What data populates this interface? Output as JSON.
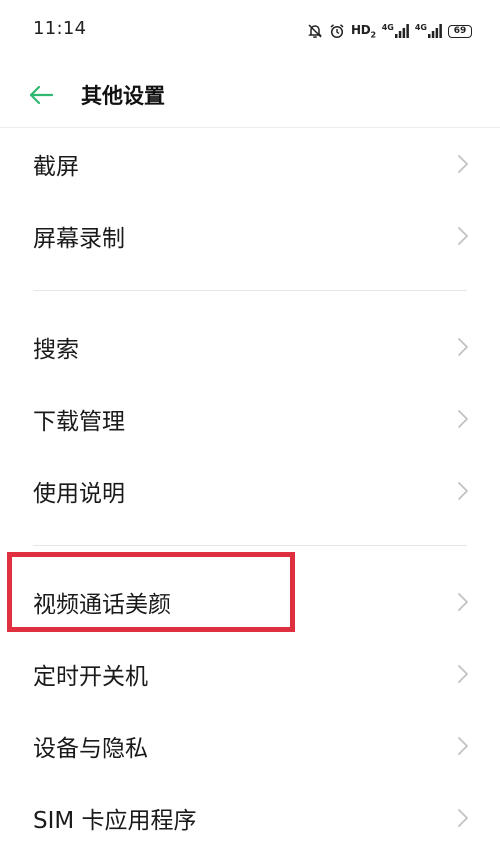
{
  "status_bar": {
    "time": "11:14",
    "hd_label": "HD",
    "hd_sub": "2",
    "network_1": "4G",
    "network_2": "4G",
    "battery": "69",
    "icons": [
      "mute-bell-icon",
      "alarm-clock-icon",
      "signal-4g-icon",
      "signal-4g-icon",
      "battery-icon"
    ]
  },
  "header": {
    "title": "其他设置",
    "back_icon": "arrow-left-icon",
    "accent_color": "#2eb872"
  },
  "items": [
    {
      "label": "截屏"
    },
    {
      "label": "屏幕录制"
    },
    {
      "label": "搜索"
    },
    {
      "label": "下载管理"
    },
    {
      "label": "使用说明"
    },
    {
      "label": "视频通话美颜"
    },
    {
      "label": "定时开关机"
    },
    {
      "label": "设备与隐私"
    },
    {
      "label": "SIM 卡应用程序"
    }
  ],
  "highlight_color": "#e0303f"
}
